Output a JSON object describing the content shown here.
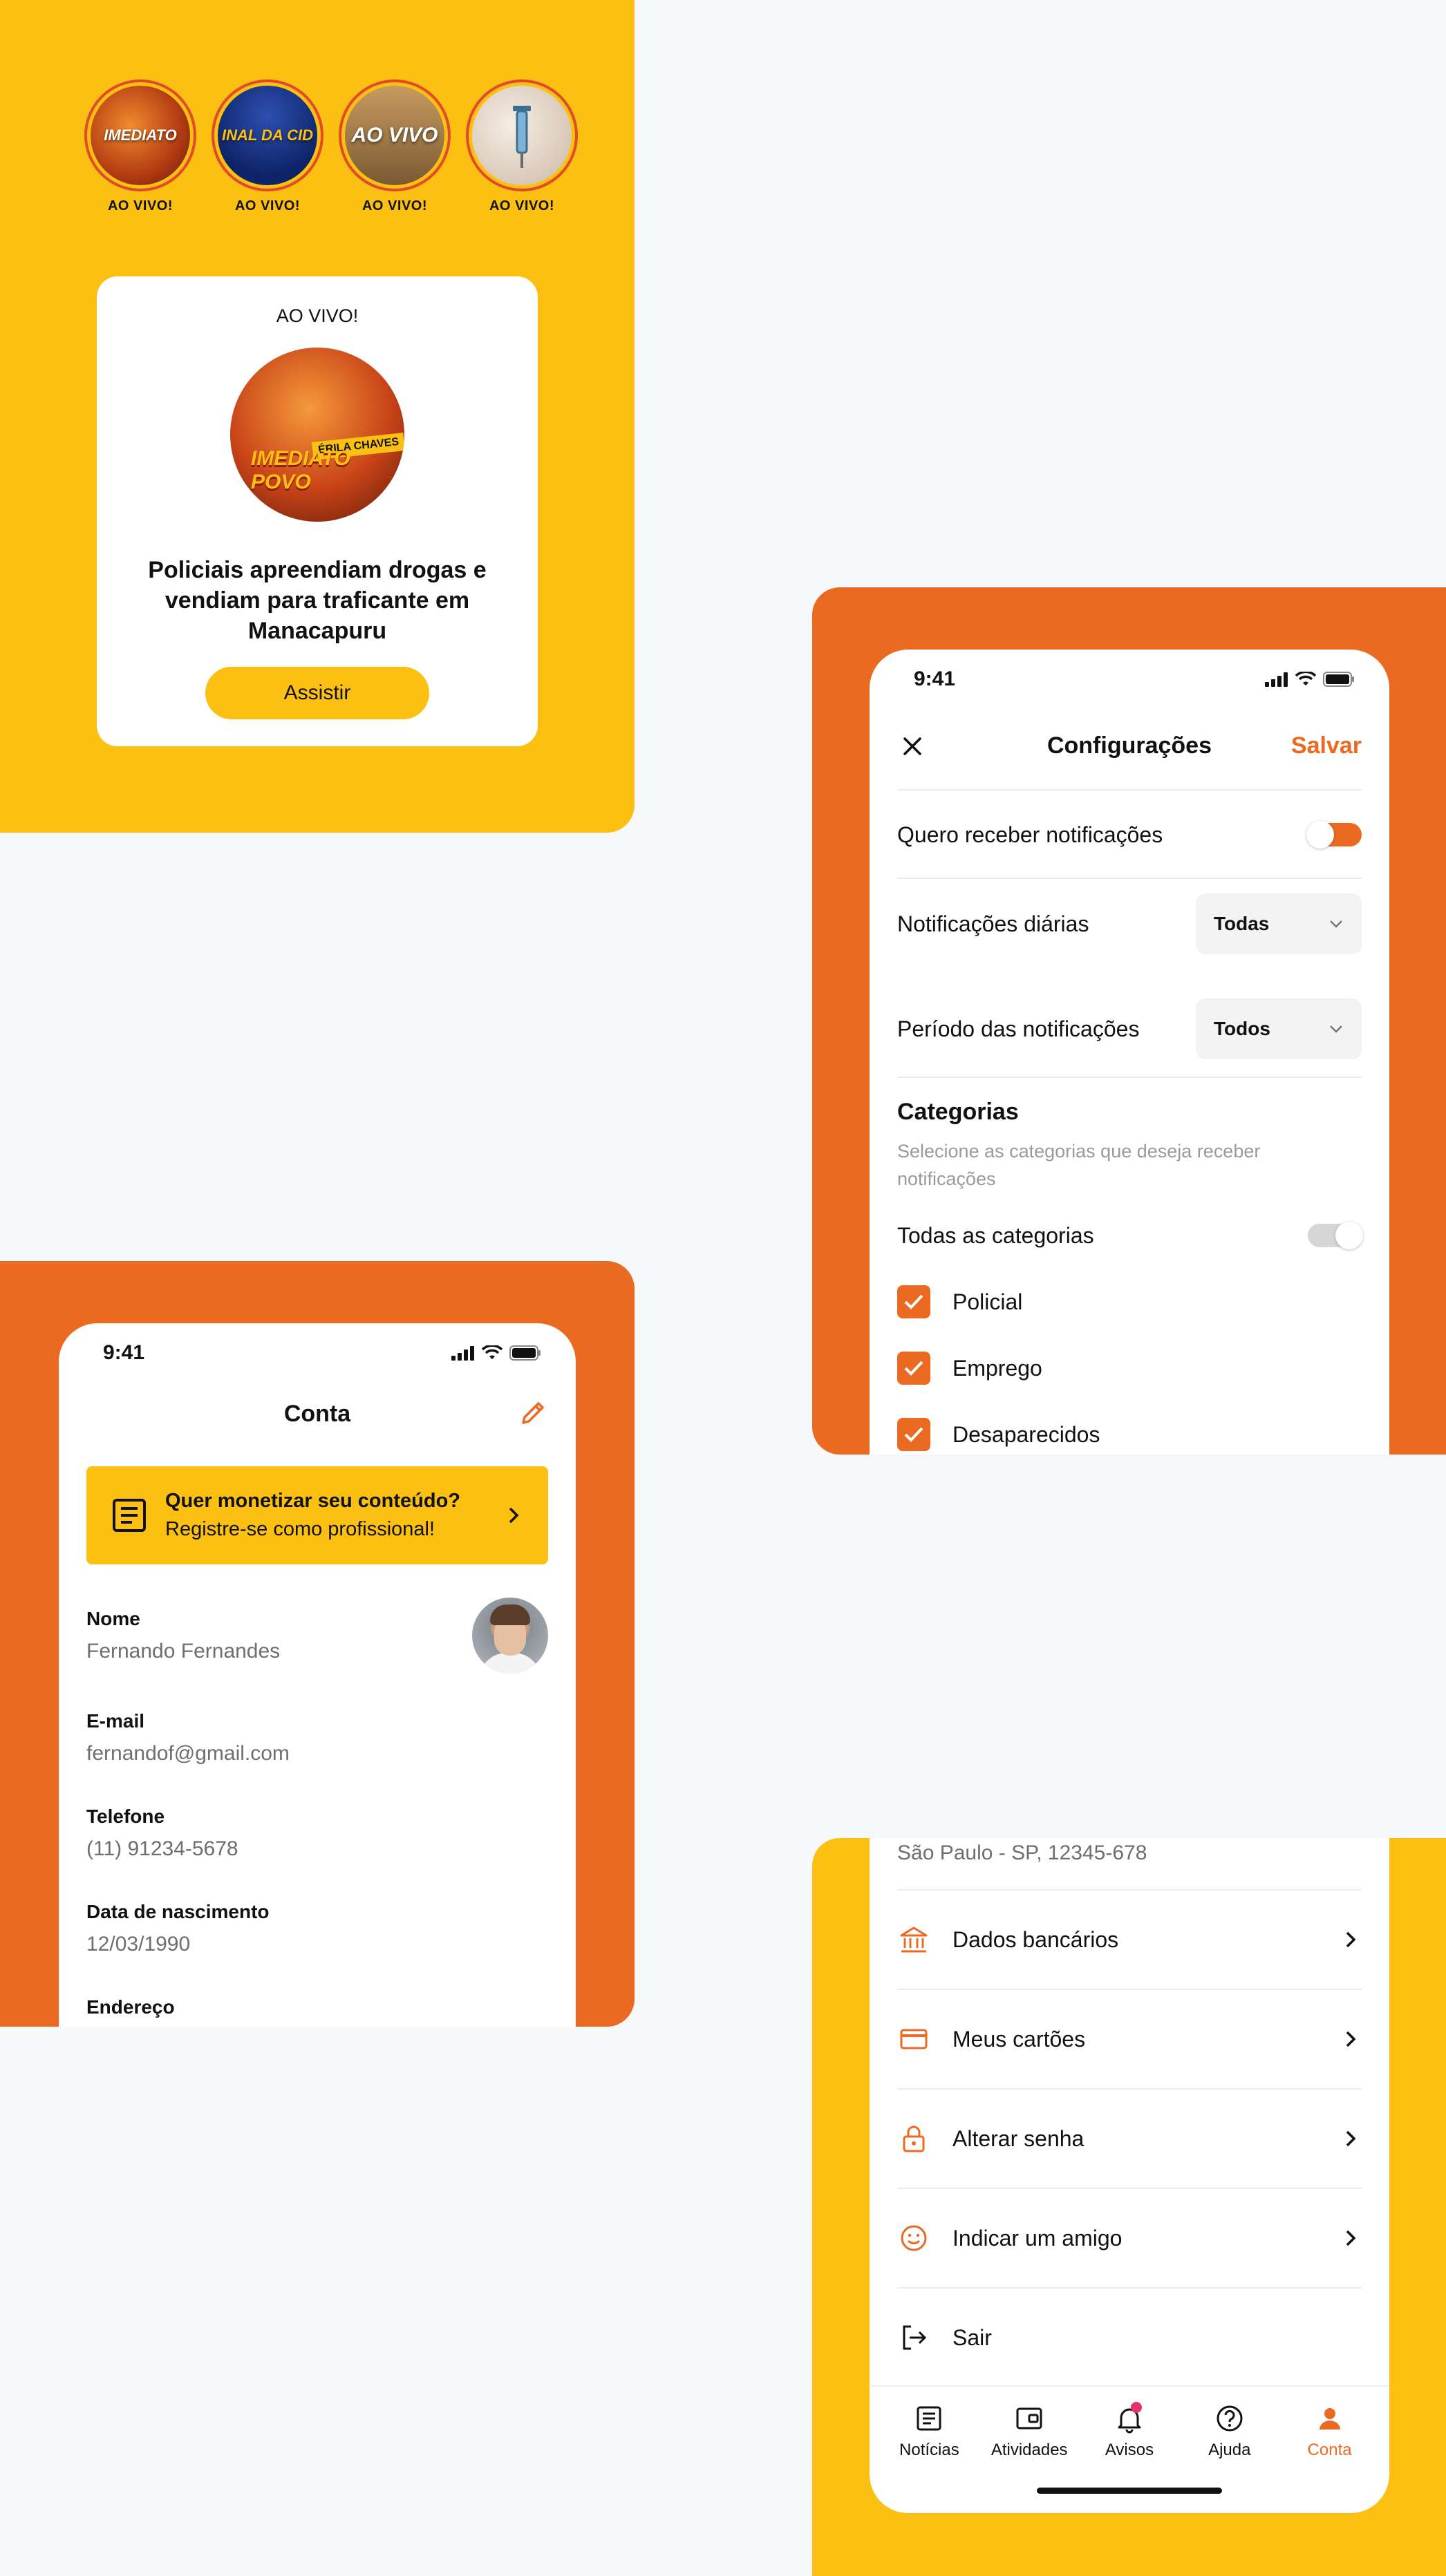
{
  "live": {
    "stories": [
      {
        "label": "AO VIVO!",
        "thumb_text": "IMEDIATO"
      },
      {
        "label": "AO VIVO!",
        "thumb_text": "INAL DA CID"
      },
      {
        "label": "AO VIVO!",
        "thumb_text": "AO VIVO"
      },
      {
        "label": "AO VIVO!",
        "thumb_text": ""
      }
    ],
    "card": {
      "badge": "AO VIVO!",
      "brand": "IMEDIATO POVO",
      "host": "ÉRILA CHAVES",
      "title": "Policiais apreendiam drogas e vendiam para traficante em Manacapuru",
      "button": "Assistir"
    }
  },
  "settings": {
    "time": "9:41",
    "title": "Configurações",
    "save": "Salvar",
    "notify_label": "Quero receber notificações",
    "notify_on": true,
    "daily_label": "Notificações diárias",
    "daily_value": "Todas",
    "period_label": "Período das notificações",
    "period_value": "Todos",
    "categories_title": "Categorias",
    "categories_sub": "Selecione as categorias que deseja receber notificações",
    "all_categories": "Todas as categorias",
    "all_categories_on": false,
    "categories": [
      {
        "label": "Policial",
        "checked": true
      },
      {
        "label": "Emprego",
        "checked": true
      },
      {
        "label": "Desaparecidos",
        "checked": true
      }
    ]
  },
  "account": {
    "time": "9:41",
    "title": "Conta",
    "promo_title": "Quer monetizar seu conteúdo?",
    "promo_sub": "Registre-se como profissional!",
    "fields": [
      {
        "key": "Nome",
        "value": "Fernando Fernandes"
      },
      {
        "key": "E-mail",
        "value": "fernandof@gmail.com"
      },
      {
        "key": "Telefone",
        "value": "(11) 91234-5678"
      },
      {
        "key": "Data de nascimento",
        "value": "12/03/1990"
      },
      {
        "key": "Endereço",
        "value": ""
      }
    ]
  },
  "menu": {
    "address": "São Paulo - SP, 12345-678",
    "items": [
      {
        "label": "Dados bancários",
        "icon": "bank-icon"
      },
      {
        "label": "Meus cartões",
        "icon": "credit-card-icon"
      },
      {
        "label": "Alterar senha",
        "icon": "lock-icon"
      },
      {
        "label": "Indicar um amigo",
        "icon": "smile-icon"
      },
      {
        "label": "Sair",
        "icon": "logout-icon"
      }
    ],
    "tabs": [
      {
        "label": "Notícias",
        "icon": "news-icon"
      },
      {
        "label": "Atividades",
        "icon": "wallet-icon"
      },
      {
        "label": "Avisos",
        "icon": "bell-icon"
      },
      {
        "label": "Ajuda",
        "icon": "help-icon"
      },
      {
        "label": "Conta",
        "icon": "user-icon",
        "active": true
      }
    ]
  },
  "colors": {
    "yellow": "#FBC012",
    "orange": "#EA6A22",
    "background": "#F7F8FA",
    "badge": "#E53170"
  }
}
